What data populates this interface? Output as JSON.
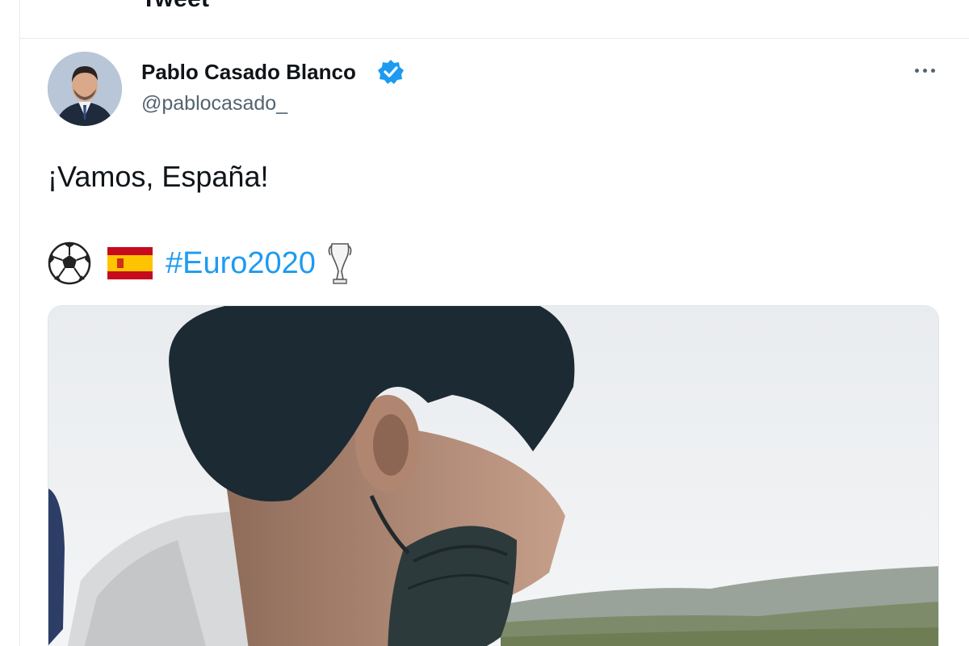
{
  "header": {
    "title": "Tweet",
    "back_icon": "back-arrow-icon"
  },
  "tweet": {
    "author": {
      "name": "Pablo Casado Blanco",
      "handle": "@pablocasado_",
      "verified": true,
      "verified_icon": "verified-badge-icon"
    },
    "more_icon": "more-options-icon",
    "text": "¡Vamos, España!",
    "emojis": [
      "soccer-ball-icon",
      "spain-flag-icon",
      "trophy-icon"
    ],
    "hashtag": "#Euro2020",
    "media": {
      "type": "photo"
    }
  },
  "colors": {
    "accent": "#1d9bf0",
    "text": "#0f1419",
    "secondary_text": "#536471",
    "border": "#e6ecf0"
  }
}
